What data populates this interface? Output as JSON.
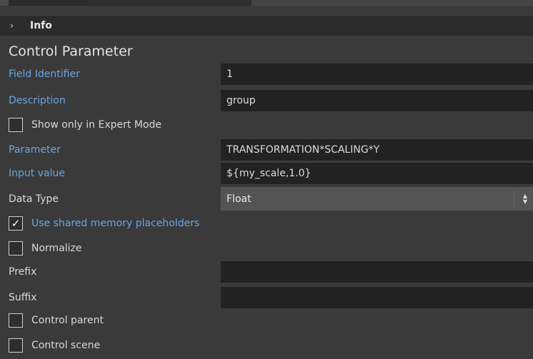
{
  "info": {
    "title": "Info"
  },
  "section": {
    "title": "Control Parameter"
  },
  "fields": {
    "field_identifier": {
      "label": "Field Identifier",
      "value": "1"
    },
    "description": {
      "label": "Description",
      "value": "group"
    },
    "parameter": {
      "label": "Parameter",
      "value": "TRANSFORMATION*SCALING*Y"
    },
    "input_value": {
      "label": "Input value",
      "value": "${my_scale,1.0}"
    },
    "data_type": {
      "label": "Data Type",
      "value": "Float"
    },
    "prefix": {
      "label": "Prefix",
      "value": ""
    },
    "suffix": {
      "label": "Suffix",
      "value": ""
    }
  },
  "checkboxes": {
    "expert_mode": {
      "label": "Show only in Expert Mode",
      "checked": false
    },
    "shared_memory": {
      "label": "Use shared memory placeholders",
      "checked": true
    },
    "normalize": {
      "label": "Normalize",
      "checked": false
    },
    "control_parent": {
      "label": "Control parent",
      "checked": false
    },
    "control_scene": {
      "label": "Control scene",
      "checked": false
    }
  },
  "colors": {
    "accent_label": "#6aa6e6",
    "background": "#3a3a3a",
    "field_bg": "#222222"
  }
}
